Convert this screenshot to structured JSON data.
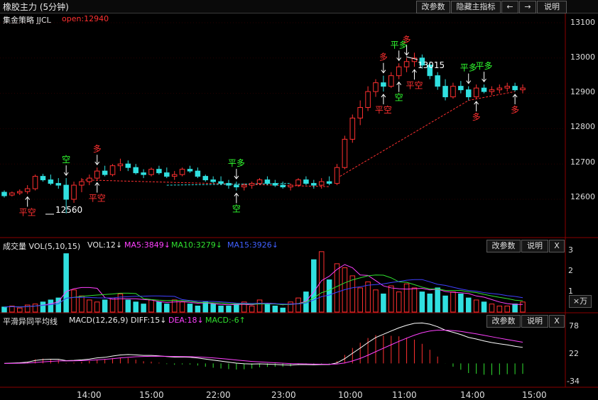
{
  "header": {
    "title": "橡胶主力 (5分钟)",
    "btn_params": "改参数",
    "btn_hide": "隐藏主指标",
    "btn_prev": "←",
    "btn_next": "→",
    "btn_help": "说明"
  },
  "price_panel": {
    "strategy": "集金策略 JJCL",
    "open_label": "open:12940",
    "yaxis_ticks": [
      "13100",
      "13000",
      "12900",
      "12800",
      "12700",
      "12600"
    ],
    "high_label": "13015",
    "low_label": "12560"
  },
  "signals": [
    {
      "text": "平空",
      "color": "#ff3030"
    },
    {
      "text": "空",
      "color": "#30ff30"
    },
    {
      "text": "多",
      "color": "#ff3030"
    },
    {
      "text": "平空",
      "color": "#ff3030"
    },
    {
      "text": "平多",
      "color": "#30ff30"
    },
    {
      "text": "空",
      "color": "#30ff30"
    },
    {
      "text": "多",
      "color": "#ff3030"
    },
    {
      "text": "平多",
      "color": "#30ff30"
    },
    {
      "text": "多",
      "color": "#ff3030"
    },
    {
      "text": "平空",
      "color": "#ff3030"
    },
    {
      "text": "空",
      "color": "#30ff30"
    },
    {
      "text": "平空",
      "color": "#ff3030"
    },
    {
      "text": "平多",
      "color": "#30ff30"
    },
    {
      "text": "平多",
      "color": "#30ff30"
    },
    {
      "text": "多",
      "color": "#ff3030"
    },
    {
      "text": "多",
      "color": "#ff3030"
    }
  ],
  "volume_panel": {
    "title": "成交量 VOL(5,10,15)",
    "vol": "VOL:12↓",
    "ma5": "MA5:3849↓",
    "ma10": "MA10:3279↓",
    "ma15": "MA15:3926↓",
    "btn_params": "改参数",
    "btn_help": "说明",
    "btn_close": "X",
    "yaxis_ticks": [
      "3",
      "2",
      "1"
    ],
    "unit": "×万"
  },
  "macd_panel": {
    "title": "平滑异同平均线",
    "params": "MACD(12,26,9)",
    "diff": "DIFF:15↓",
    "dea": "DEA:18↓",
    "macd": "MACD:-6↑",
    "btn_params": "改参数",
    "btn_help": "说明",
    "btn_close": "X",
    "yaxis_ticks": [
      "78",
      "22",
      "-34"
    ]
  },
  "time_axis": [
    "14:00",
    "15:00",
    "22:00",
    "23:00",
    "10:00",
    "11:00",
    "14:00",
    "15:00"
  ],
  "colors": {
    "up": "#ff3030",
    "down": "#30e0e0",
    "ma5": "#ff40ff",
    "ma10": "#30e030",
    "ma15": "#4040ff",
    "diff": "#ffffff",
    "dea": "#ff40ff"
  },
  "chart_data": {
    "type": "candlestick",
    "title": "橡胶主力 (5分钟)",
    "ylim": [
      12540,
      13110
    ],
    "candles_ohlc": [
      [
        12620,
        12625,
        12605,
        12610
      ],
      [
        12612,
        12622,
        12608,
        12618
      ],
      [
        12618,
        12628,
        12612,
        12622
      ],
      [
        12622,
        12640,
        12615,
        12630
      ],
      [
        12630,
        12670,
        12625,
        12665
      ],
      [
        12665,
        12672,
        12650,
        12655
      ],
      [
        12655,
        12670,
        12640,
        12645
      ],
      [
        12645,
        12660,
        12630,
        12640
      ],
      [
        12640,
        12660,
        12560,
        12600
      ],
      [
        12600,
        12650,
        12590,
        12640
      ],
      [
        12640,
        12660,
        12620,
        12650
      ],
      [
        12650,
        12670,
        12640,
        12660
      ],
      [
        12660,
        12690,
        12655,
        12680
      ],
      [
        12680,
        12695,
        12665,
        12670
      ],
      [
        12670,
        12700,
        12665,
        12695
      ],
      [
        12695,
        12715,
        12680,
        12700
      ],
      [
        12700,
        12710,
        12680,
        12690
      ],
      [
        12690,
        12700,
        12670,
        12675
      ],
      [
        12675,
        12685,
        12660,
        12670
      ],
      [
        12670,
        12690,
        12665,
        12685
      ],
      [
        12685,
        12695,
        12670,
        12675
      ],
      [
        12675,
        12690,
        12660,
        12665
      ],
      [
        12665,
        12680,
        12655,
        12670
      ],
      [
        12670,
        12690,
        12665,
        12685
      ],
      [
        12685,
        12695,
        12675,
        12680
      ],
      [
        12680,
        12690,
        12660,
        12665
      ],
      [
        12665,
        12670,
        12650,
        12655
      ],
      [
        12655,
        12665,
        12645,
        12650
      ],
      [
        12650,
        12665,
        12640,
        12645
      ],
      [
        12645,
        12655,
        12630,
        12640
      ],
      [
        12640,
        12650,
        12625,
        12635
      ],
      [
        12635,
        12645,
        12625,
        12640
      ],
      [
        12640,
        12650,
        12630,
        12645
      ],
      [
        12645,
        12660,
        12640,
        12655
      ],
      [
        12655,
        12665,
        12640,
        12645
      ],
      [
        12645,
        12655,
        12635,
        12640
      ],
      [
        12640,
        12650,
        12630,
        12635
      ],
      [
        12635,
        12645,
        12625,
        12640
      ],
      [
        12640,
        12660,
        12635,
        12655
      ],
      [
        12655,
        12665,
        12640,
        12645
      ],
      [
        12645,
        12655,
        12630,
        12640
      ],
      [
        12640,
        12660,
        12630,
        12650
      ],
      [
        12650,
        12665,
        12640,
        12645
      ],
      [
        12645,
        12700,
        12640,
        12690
      ],
      [
        12690,
        12780,
        12685,
        12770
      ],
      [
        12770,
        12840,
        12760,
        12830
      ],
      [
        12830,
        12880,
        12810,
        12860
      ],
      [
        12860,
        12920,
        12850,
        12905
      ],
      [
        12905,
        12940,
        12890,
        12930
      ],
      [
        12930,
        12950,
        12905,
        12920
      ],
      [
        12920,
        12960,
        12915,
        12950
      ],
      [
        12950,
        12985,
        12940,
        12975
      ],
      [
        12975,
        13000,
        12960,
        12990
      ],
      [
        12990,
        13015,
        12975,
        13000
      ],
      [
        13000,
        13010,
        12970,
        12980
      ],
      [
        12980,
        12990,
        12940,
        12950
      ],
      [
        12950,
        12960,
        12910,
        12920
      ],
      [
        12920,
        12940,
        12880,
        12890
      ],
      [
        12890,
        12930,
        12885,
        12920
      ],
      [
        12920,
        12935,
        12900,
        12910
      ],
      [
        12910,
        12920,
        12880,
        12890
      ],
      [
        12890,
        12925,
        12885,
        12915
      ],
      [
        12915,
        12925,
        12900,
        12905
      ],
      [
        12905,
        12920,
        12895,
        12910
      ],
      [
        12910,
        12925,
        12900,
        12915
      ],
      [
        12915,
        12930,
        12905,
        12920
      ],
      [
        12920,
        12930,
        12905,
        12910
      ],
      [
        12910,
        12925,
        12900,
        12915
      ]
    ],
    "volume": [
      0.25,
      0.3,
      0.2,
      0.35,
      0.4,
      0.5,
      0.6,
      0.7,
      2.9,
      1.1,
      0.8,
      0.6,
      0.5,
      0.6,
      0.7,
      0.9,
      0.6,
      0.5,
      0.4,
      0.6,
      0.5,
      0.4,
      0.6,
      0.5,
      0.4,
      0.3,
      0.5,
      0.4,
      0.3,
      0.3,
      0.4,
      0.5,
      0.3,
      0.6,
      0.4,
      0.3,
      0.2,
      0.5,
      0.7,
      1.0,
      2.6,
      3.0,
      1.6,
      2.4,
      2.2,
      1.8,
      1.2,
      1.5,
      1.1,
      0.9,
      1.3,
      1.0,
      1.4,
      1.2,
      1.0,
      0.9,
      1.2,
      0.8,
      1.0,
      0.9,
      0.7,
      0.6,
      0.5,
      0.4,
      0.3,
      0.3,
      0.4,
      0.5
    ],
    "macd_ylim": [
      -40,
      85
    ]
  }
}
